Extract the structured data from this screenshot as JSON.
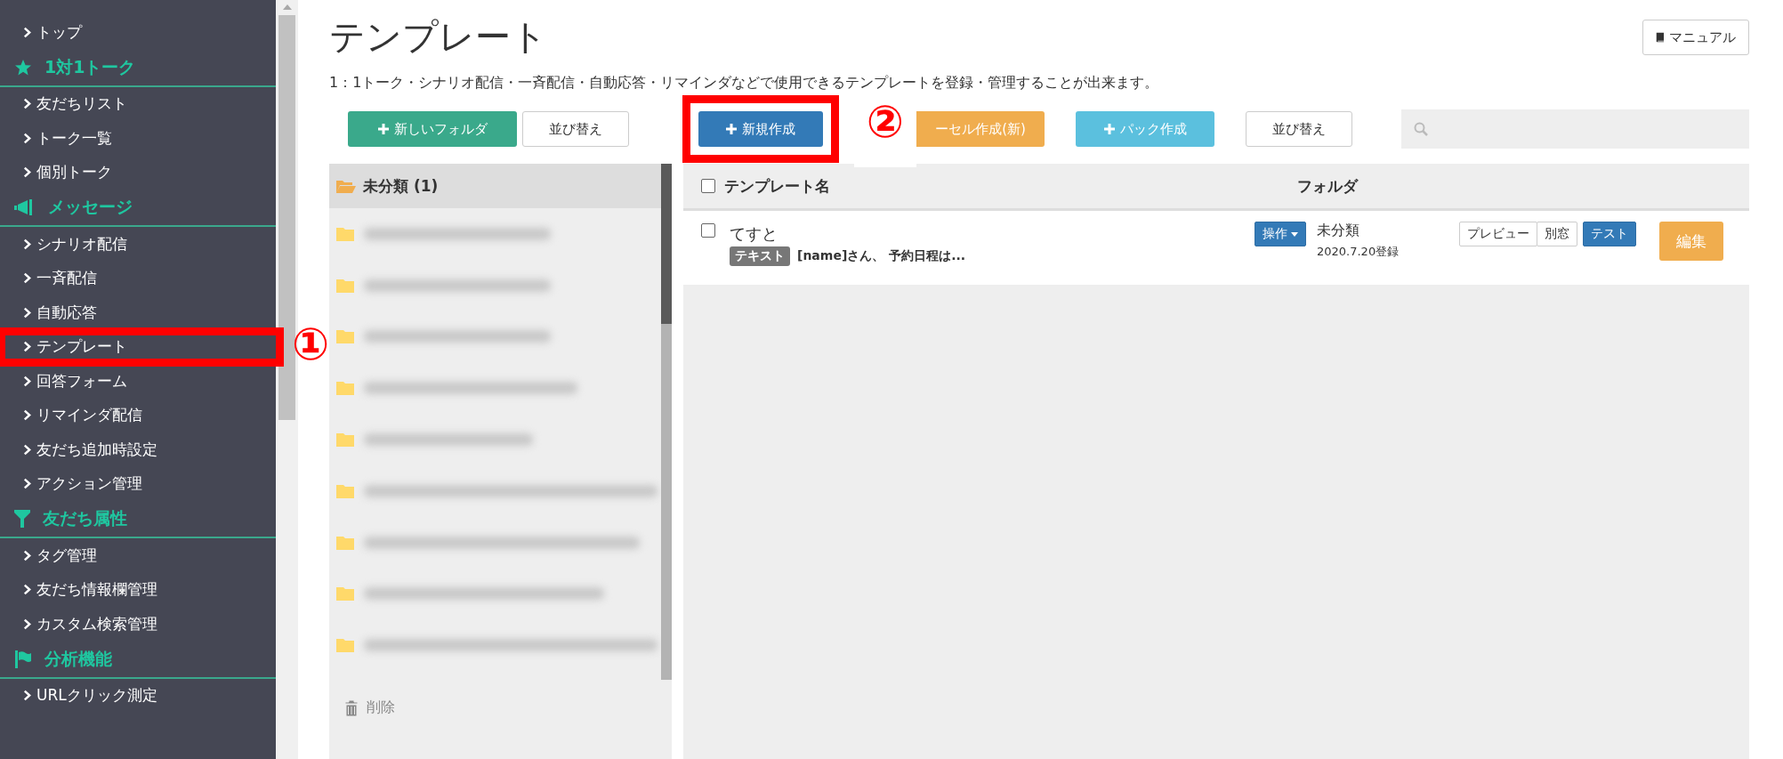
{
  "sidebar": {
    "items": [
      {
        "kind": "link",
        "label": "トップ",
        "framed": false
      },
      {
        "kind": "heading",
        "label": "1対1トーク"
      },
      {
        "kind": "link",
        "label": "友だちリスト",
        "framed": false
      },
      {
        "kind": "link",
        "label": "トーク一覧",
        "framed": false
      },
      {
        "kind": "link",
        "label": "個別トーク",
        "framed": false
      },
      {
        "kind": "heading",
        "label": "メッセージ"
      },
      {
        "kind": "link",
        "label": "シナリオ配信",
        "framed": false
      },
      {
        "kind": "link",
        "label": "一斉配信",
        "framed": false
      },
      {
        "kind": "link",
        "label": "自動応答",
        "framed": false
      },
      {
        "kind": "link",
        "label": "テンプレート",
        "framed": true
      },
      {
        "kind": "link",
        "label": "回答フォーム",
        "framed": false
      },
      {
        "kind": "link",
        "label": "リマインダ配信",
        "framed": false
      },
      {
        "kind": "link",
        "label": "友だち追加時設定",
        "framed": false
      },
      {
        "kind": "link",
        "label": "アクション管理",
        "framed": false
      },
      {
        "kind": "heading",
        "label": "友だち属性"
      },
      {
        "kind": "link",
        "label": "タグ管理",
        "framed": false
      },
      {
        "kind": "link",
        "label": "友だち情報欄管理",
        "framed": false
      },
      {
        "kind": "link",
        "label": "カスタム検索管理",
        "framed": false
      },
      {
        "kind": "heading",
        "label": "分析機能"
      },
      {
        "kind": "link",
        "label": "URLクリック測定",
        "framed": false
      }
    ]
  },
  "page": {
    "title": "テンプレート",
    "description": "1：1トーク・シナリオ配信・一斉配信・自動応答・リマインダなどで使用できるテンプレートを登録・管理することが出来ます。",
    "manual_button": "マニュアル"
  },
  "toolbar": {
    "left_buttons": [
      {
        "kind": "success",
        "label": "新しいフォルダ",
        "framed": false
      },
      {
        "kind": "default",
        "label": "並び替え",
        "framed": false
      }
    ],
    "right_buttons": [
      {
        "kind": "primary",
        "label": "新規作成",
        "framed": true
      },
      {
        "kind": "warning",
        "label": "ーセル作成(新)",
        "framed": false
      },
      {
        "kind": "info",
        "label": "パック作成",
        "framed": false
      },
      {
        "kind": "default",
        "label": "並び替え",
        "framed": false
      }
    ]
  },
  "markers": [
    "①",
    "②"
  ],
  "folders": {
    "header": "未分類 (1)",
    "items": [
      {
        "kind": "redacted"
      },
      {
        "kind": "redacted"
      },
      {
        "kind": "redacted"
      },
      {
        "kind": "redacted"
      },
      {
        "kind": "redacted"
      },
      {
        "kind": "redacted"
      },
      {
        "kind": "redacted"
      },
      {
        "kind": "redacted"
      },
      {
        "kind": "redacted"
      }
    ],
    "delete": "削除"
  },
  "table": {
    "columns": [
      "テンプレート名",
      "フォルダ"
    ],
    "all_checked": false,
    "rows": [
      {
        "checked": false,
        "name": "てすと",
        "tag": "テキスト",
        "preview": "[name]さん、 予約日程は...",
        "action_button": "操作",
        "folder": "未分類",
        "registered": "2020.7.20登録",
        "buttons": [
          "プレビュー",
          "別窓",
          "テスト"
        ],
        "edit_button": "編集"
      }
    ]
  }
}
